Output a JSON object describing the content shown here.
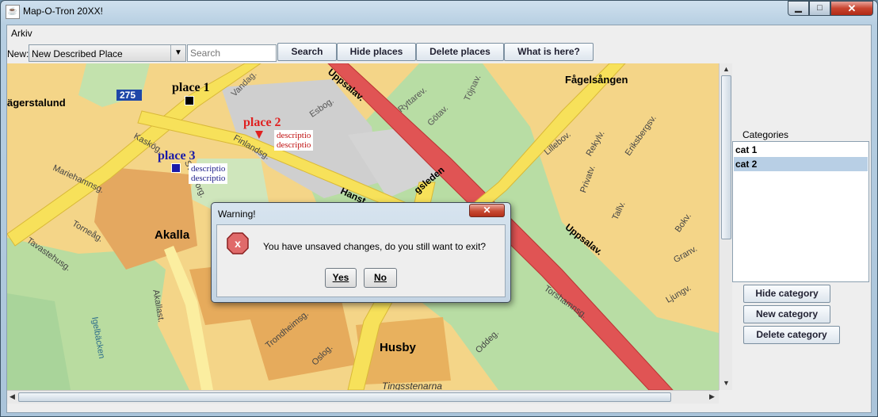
{
  "window": {
    "title": "Map-O-Tron 20XX!",
    "app_icon": "java-icon",
    "controls": {
      "minimize": "▁",
      "maximize": "□",
      "close": "✕"
    }
  },
  "menu": {
    "items": [
      "Arkiv"
    ]
  },
  "toolbar": {
    "new_label": "New:",
    "place_type_selected": "New Described Place",
    "search_placeholder": "Search",
    "buttons": [
      "Search",
      "Hide places",
      "Delete places",
      "What is here?"
    ]
  },
  "map": {
    "streets": [
      "ägerstalund",
      "275",
      "Vandag.",
      "Esbog.",
      "Uppsalav.",
      "Ryttarev.",
      "Götav.",
      "Töjnav.",
      "Fågelsången",
      "Kaskög.",
      "Finlandsg.",
      "Sveaborg.",
      "Mariehamnsg.",
      "Hanst",
      "gsleden",
      "Akalla",
      "Torneåg.",
      "Tavastehusg.",
      "Akallast.",
      "Igelbäcken",
      "Trondheimsg.",
      "Oslog.",
      "Husby",
      "Oddeg.",
      "Torshamnsg.",
      "Tingsstenarna",
      "Ljungv.",
      "Granv.",
      "Bokv.",
      "Tallv.",
      "Privatv.",
      "Lillebov.",
      "Rekylv.",
      "Eriksbergsv.",
      "Uppsalav."
    ],
    "places": [
      {
        "name": "place 1",
        "color": "#000000",
        "descriptions": []
      },
      {
        "name": "place 2",
        "color": "#e02020",
        "descriptions": [
          "descriptio",
          "descriptio"
        ]
      },
      {
        "name": "place 3",
        "color": "#1a1aa8",
        "descriptions": [
          "descriptio",
          "descriptio"
        ]
      }
    ]
  },
  "categories": {
    "title": "Categories",
    "items": [
      {
        "label": "cat 1",
        "selected": false
      },
      {
        "label": "cat 2",
        "selected": true
      }
    ],
    "buttons": [
      "Hide category",
      "New category",
      "Delete category"
    ]
  },
  "dialog": {
    "title": "Warning!",
    "message": "You have unsaved changes, do you still want to exit?",
    "yes": "Yes",
    "no": "No",
    "close": "✕",
    "icon": "error-icon"
  }
}
